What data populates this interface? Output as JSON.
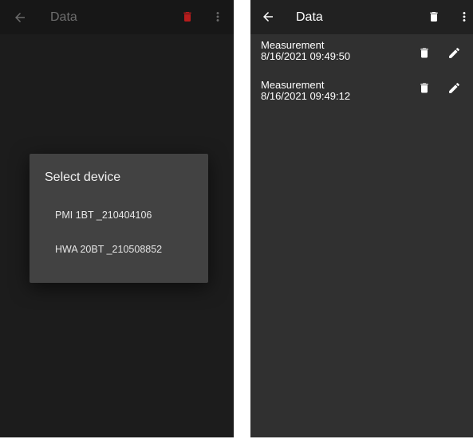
{
  "left": {
    "title": "Data",
    "dialog": {
      "title": "Select device",
      "options": [
        "PMI 1BT _210404106",
        "HWA 20BT _210508852"
      ]
    }
  },
  "right": {
    "title": "Data",
    "items": [
      {
        "name": "Measurement",
        "timestamp": "8/16/2021 09:49:50"
      },
      {
        "name": "Measurement",
        "timestamp": "8/16/2021 09:49:12"
      }
    ]
  },
  "icons": {
    "back": "arrow-back-icon",
    "delete": "trash-icon",
    "more": "more-vert-icon",
    "edit": "pencil-icon"
  },
  "colors": {
    "left_trash_icon": "#b71c1c",
    "dialog_background": "#424242",
    "list_background": "#303030"
  }
}
